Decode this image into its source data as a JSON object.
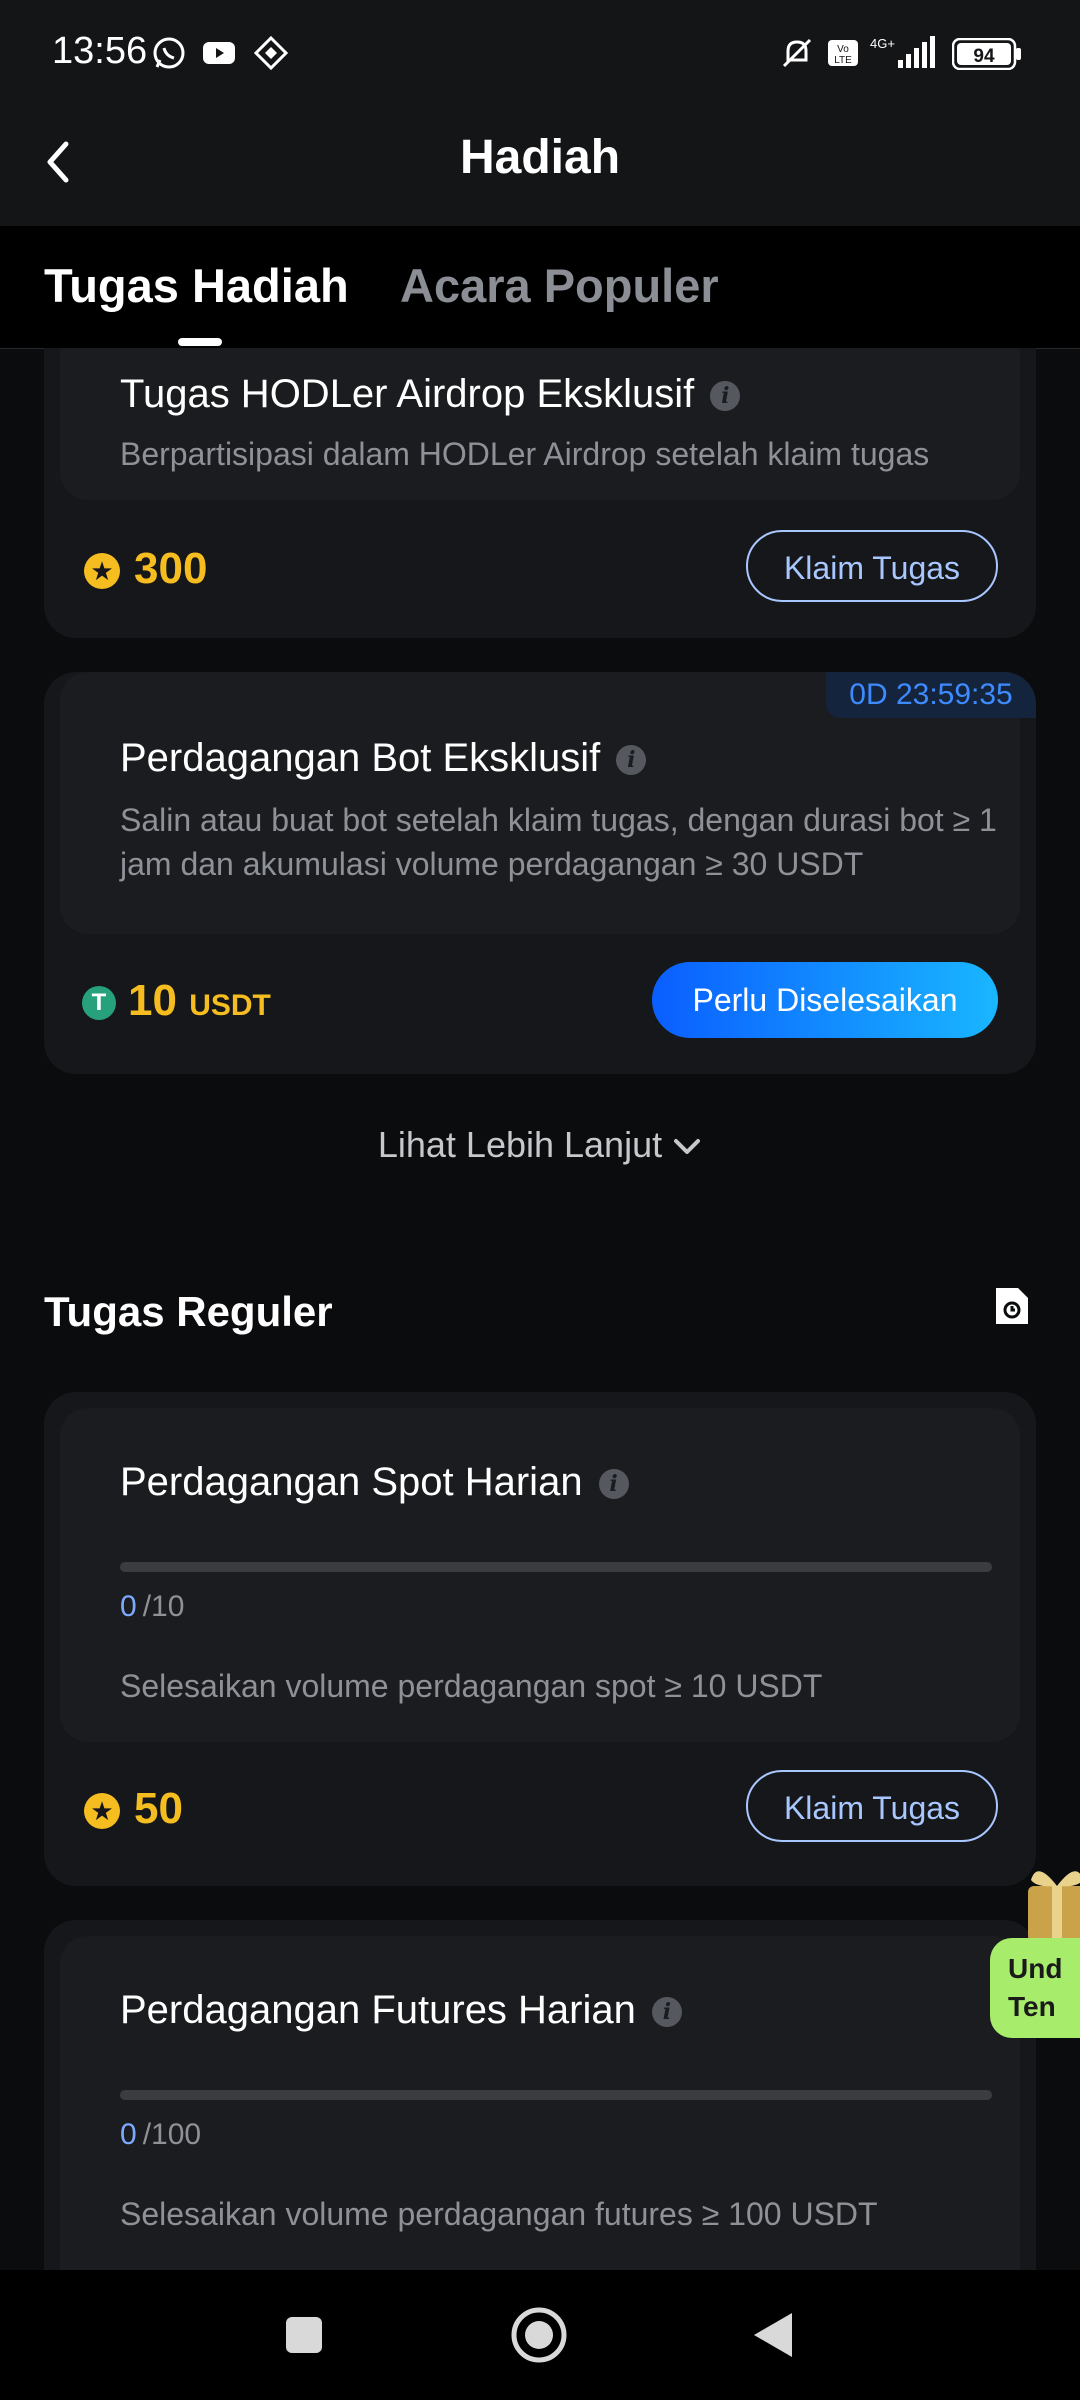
{
  "status_bar": {
    "time": "13:56",
    "battery": "94",
    "network": "4G+"
  },
  "header": {
    "title": "Hadiah"
  },
  "tabs": [
    {
      "label": "Tugas Hadiah",
      "active": true
    },
    {
      "label": "Acara Populer",
      "active": false
    }
  ],
  "exclusive_tasks": [
    {
      "title": "Tugas HODLer Airdrop Eksklusif",
      "description": "Berpartisipasi dalam HODLer Airdrop setelah klaim tugas",
      "reward_value": "300",
      "reward_icon": "star-icon",
      "button": "Klaim Tugas"
    },
    {
      "timer": "0D 23:59:35",
      "title": "Perdagangan Bot Eksklusif",
      "description": "Salin atau buat bot setelah klaim tugas, dengan durasi bot ≥ 1 jam dan akumulasi volume perdagangan ≥ 30 USDT",
      "reward_value": "10",
      "reward_unit": "USDT",
      "reward_icon": "usdt-icon",
      "button": "Perlu Diselesaikan"
    }
  ],
  "see_more": "Lihat Lebih Lanjut",
  "regular_section": {
    "title": "Tugas Reguler"
  },
  "regular_tasks": [
    {
      "title": "Perdagangan Spot Harian",
      "progress_current": "0",
      "progress_total": "/10",
      "progress_fraction": 0,
      "description": "Selesaikan volume perdagangan spot ≥ 10 USDT",
      "reward_value": "50",
      "button": "Klaim Tugas"
    },
    {
      "title": "Perdagangan Futures Harian",
      "progress_current": "0",
      "progress_total": "/100",
      "progress_fraction": 0,
      "description": "Selesaikan volume perdagangan futures ≥ 100 USDT"
    }
  ],
  "promo": {
    "line1": "Und",
    "line2": "Ten"
  },
  "colors": {
    "accent": "#2f7cff",
    "reward": "#f5bd1f",
    "outline_button": "#a9c7ff",
    "promo": "#a7ec6a"
  }
}
